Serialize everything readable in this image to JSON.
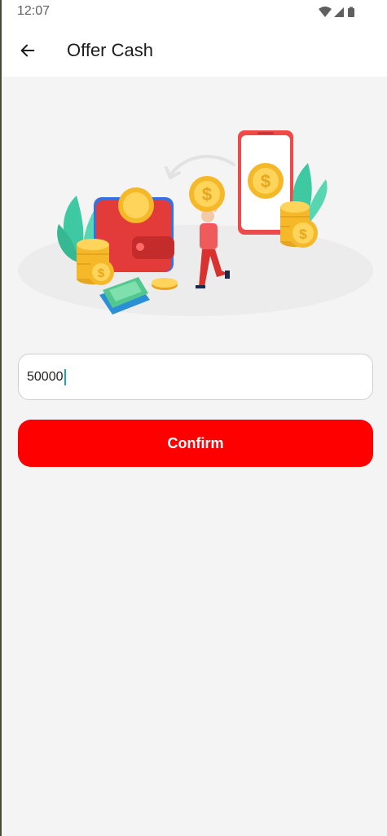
{
  "status_bar": {
    "time": "12:07",
    "icons": [
      "wifi-icon",
      "signal-icon",
      "battery-icon"
    ]
  },
  "header": {
    "title": "Offer Cash",
    "back_icon": "arrow-left-icon"
  },
  "illustration": {
    "subject": "wallet-phone-coins-illustration"
  },
  "amount_input": {
    "value": "50000"
  },
  "confirm": {
    "label": "Confirm"
  },
  "colors": {
    "primary": "#ff0000",
    "background": "#f4f4f4",
    "surface": "#ffffff",
    "caret": "#1aa8b0"
  }
}
